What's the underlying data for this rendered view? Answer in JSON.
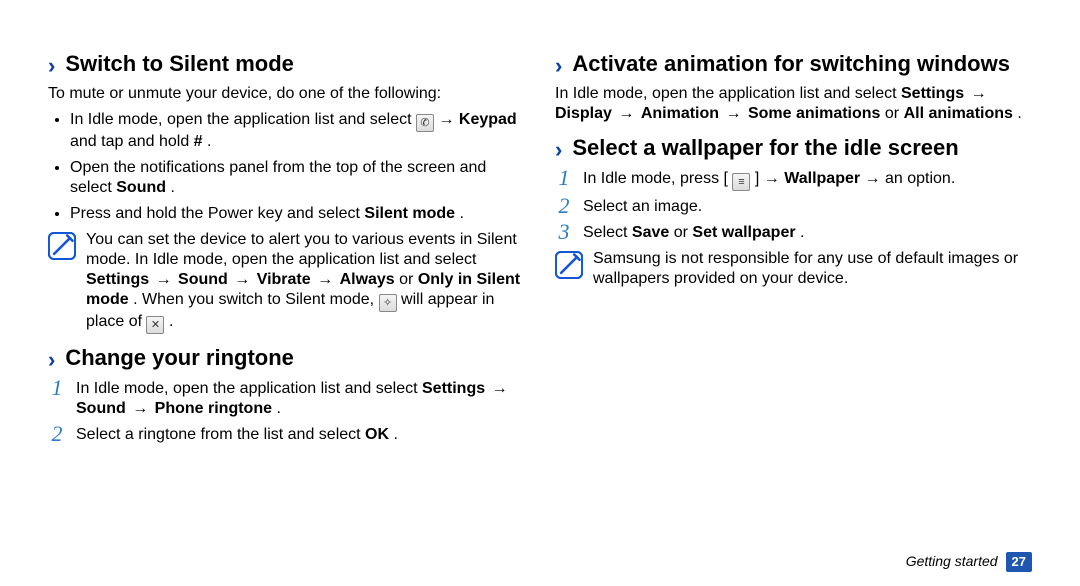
{
  "left": {
    "sec1": {
      "title": "Switch to Silent mode",
      "intro": "To mute or unmute your device, do one of the following:",
      "b1a": "In Idle mode, open the application list and select ",
      "b1b": " → ",
      "b1c": "Keypad",
      "b1d": " and tap and hold ",
      "b1e": "#",
      "b1f": ".",
      "b2a": "Open the notifications panel from the top of the screen and select ",
      "b2b": "Sound",
      "b2c": ".",
      "b3a": "Press and hold the Power key and select ",
      "b3b": "Silent mode",
      "b3c": ".",
      "note1a": "You can set the device to alert you to various events in Silent mode. In Idle mode, open the application list and select ",
      "note1b": "Settings",
      "note1c": " → ",
      "note1d": "Sound",
      "note1e": " → ",
      "note1f": "Vibrate",
      "note1g": " → ",
      "note1h": "Always",
      "note1i": " or ",
      "note1j": "Only in Silent mode",
      "note1k": ". When you switch to Silent mode, ",
      "note1l": " will appear in place of ",
      "note1m": "."
    },
    "sec2": {
      "title": "Change your ringtone",
      "s1a": "In Idle mode, open the application list and select ",
      "s1b": "Settings",
      "s1c": " → ",
      "s1d": "Sound",
      "s1e": " → ",
      "s1f": "Phone ringtone",
      "s1g": ".",
      "s2a": "Select a ringtone from the list and select ",
      "s2b": "OK",
      "s2c": "."
    }
  },
  "right": {
    "sec3": {
      "title": "Activate animation for switching windows",
      "p1a": "In Idle mode, open the application list and select ",
      "p1b": "Settings",
      "p1c": " → ",
      "p1d": "Display",
      "p1e": " → ",
      "p1f": "Animation",
      "p1g": " → ",
      "p1h": "Some animations",
      "p1i": " or ",
      "p1j": "All animations",
      "p1k": "."
    },
    "sec4": {
      "title": "Select a wallpaper for the idle screen",
      "s1a": "In Idle mode, press [",
      "s1b": "] → ",
      "s1c": "Wallpaper",
      "s1d": " → an option.",
      "s2": "Select an image.",
      "s3a": "Select ",
      "s3b": "Save",
      "s3c": " or ",
      "s3d": "Set wallpaper",
      "s3e": ".",
      "note": "Samsung is not responsible for any use of default images or wallpapers provided on your device."
    }
  },
  "nums": {
    "n1": "1",
    "n2": "2",
    "n3": "3"
  },
  "footer": {
    "section": "Getting started",
    "page": "27"
  }
}
